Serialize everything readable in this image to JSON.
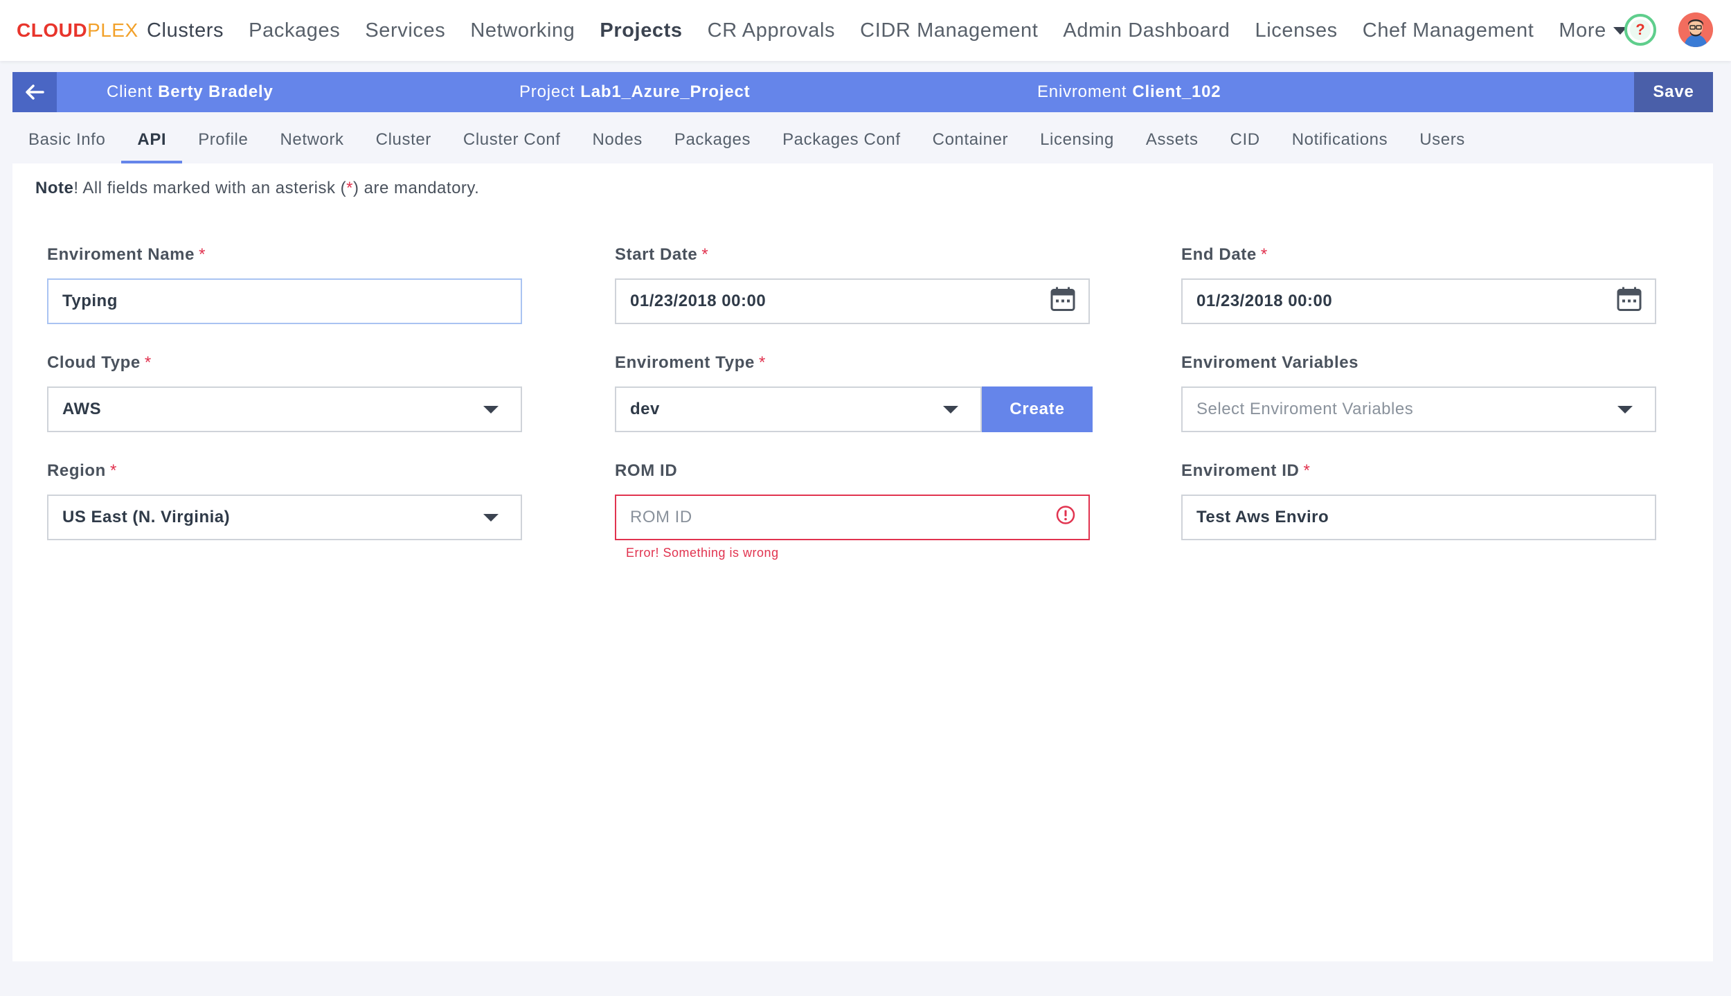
{
  "brand": {
    "part1": "CLOUD",
    "part2": "PLEX"
  },
  "nav": {
    "items": [
      "Clusters",
      "Packages",
      "Services",
      "Networking",
      "Projects",
      "CR Approvals",
      "CIDR Management",
      "Admin Dashboard",
      "Licenses",
      "Chef Management"
    ],
    "more": "More",
    "help": "?"
  },
  "context": {
    "client_label": "Client",
    "client_value": "Berty Bradely",
    "project_label": "Project",
    "project_value": "Lab1_Azure_Project",
    "env_label": "Enivroment",
    "env_value": "Client_102",
    "save": "Save"
  },
  "tabs": [
    "Basic Info",
    "API",
    "Profile",
    "Network",
    "Cluster",
    "Cluster Conf",
    "Nodes",
    "Packages",
    "Packages Conf",
    "Container",
    "Licensing",
    "Assets",
    "CID",
    "Notifications",
    "Users"
  ],
  "active_tab": "API",
  "note": {
    "bold": "Note",
    "pre": "! All fields marked with an asterisk (",
    "star": "*",
    "post": ") are mandatory."
  },
  "form": {
    "env_name": {
      "label": "Enviroment Name",
      "value": "Typing"
    },
    "start_date": {
      "label": "Start Date",
      "value": "01/23/2018 00:00"
    },
    "end_date": {
      "label": "End Date",
      "value": "01/23/2018 00:00"
    },
    "cloud_type": {
      "label": "Cloud Type",
      "value": "AWS"
    },
    "env_type": {
      "label": "Enviroment Type",
      "value": "dev",
      "button": "Create"
    },
    "env_vars": {
      "label": "Enviroment Variables",
      "placeholder": "Select Enviroment Variables"
    },
    "region": {
      "label": "Region",
      "value": "US East (N. Virginia)"
    },
    "rom_id": {
      "label": "ROM ID",
      "placeholder": "ROM ID",
      "error": "Error! Something is wrong"
    },
    "env_id": {
      "label": "Enviroment ID",
      "value": "Test Aws Enviro"
    }
  },
  "colors": {
    "accent": "#6585ea",
    "error": "#e1334f",
    "brand_red": "#e8352c",
    "brand_orange": "#f2a12a",
    "help_green": "#5fce8c"
  }
}
